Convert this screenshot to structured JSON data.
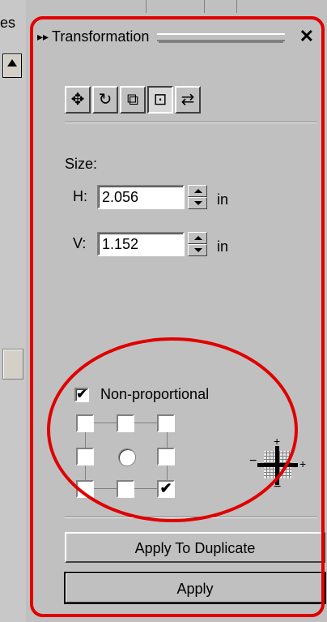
{
  "left_docker": {
    "tab_label": "es"
  },
  "docker": {
    "title": "Transformation",
    "title_arrows": "▸▸",
    "close_glyph": "✕",
    "toolbar": [
      {
        "name": "position",
        "icon": "move-arrows-icon",
        "glyph": "✥",
        "active": false
      },
      {
        "name": "rotate",
        "icon": "rotate-icon",
        "glyph": "↻",
        "active": false
      },
      {
        "name": "scale-mirror",
        "icon": "scale-mirror-icon",
        "glyph": "⧉",
        "active": false
      },
      {
        "name": "size",
        "icon": "size-icon",
        "glyph": "⊡",
        "active": true
      },
      {
        "name": "skew",
        "icon": "skew-icon",
        "glyph": "⇄",
        "active": false
      }
    ],
    "size": {
      "label": "Size:",
      "h_label": "H:",
      "h_value": "2.056",
      "v_label": "V:",
      "v_value": "1.152",
      "unit": "in"
    },
    "non_proportional": {
      "label": "Non-proportional",
      "checked": true
    },
    "anchor_grid": {
      "selected": "bottom-right",
      "check_glyph": "✔",
      "plus": "+",
      "minus": "−"
    },
    "apply_to_duplicate_label": "Apply To Duplicate",
    "apply_label": "Apply"
  },
  "annotation_color": "#e00000"
}
